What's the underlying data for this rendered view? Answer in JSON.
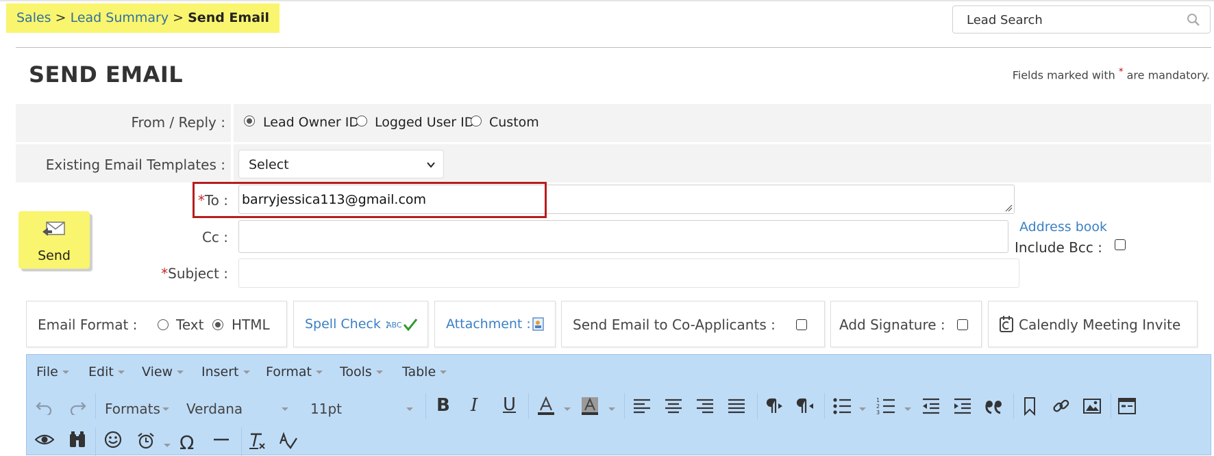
{
  "breadcrumb": {
    "items": [
      "Sales",
      "Lead Summary"
    ],
    "separator": ">",
    "current": "Send Email"
  },
  "search": {
    "placeholder": "Lead Search"
  },
  "page": {
    "title": "SEND EMAIL",
    "mandatory_prefix": "Fields marked with",
    "mandatory_star": "*",
    "mandatory_suffix": "are mandatory."
  },
  "from_reply": {
    "label": "From / Reply :",
    "options": [
      {
        "label": "Lead Owner ID",
        "selected": true
      },
      {
        "label": "Logged User ID",
        "selected": false
      },
      {
        "label": "Custom",
        "selected": false
      }
    ]
  },
  "templates": {
    "label": "Existing Email Templates :",
    "value": "Select"
  },
  "to": {
    "star": "*",
    "label": "To :",
    "value": "barryjessica113@gmail.com"
  },
  "cc": {
    "label": "Cc :",
    "value": ""
  },
  "subject": {
    "star": "*",
    "label": "Subject :",
    "value": ""
  },
  "address_book": "Address book",
  "include_bcc": {
    "label": "Include Bcc :",
    "checked": false
  },
  "send_button": {
    "label": "Send"
  },
  "options_bar": {
    "email_format": {
      "label": "Email Format :",
      "text_label": "Text",
      "html_label": "HTML",
      "selected": "HTML"
    },
    "spell_check": "Spell Check :",
    "spell_icon_text": "ABC",
    "attachment": "Attachment :",
    "co_applicants": {
      "label": "Send Email to Co-Applicants :",
      "checked": false
    },
    "signature": {
      "label": "Add Signature :",
      "checked": false
    },
    "calendly": "Calendly Meeting Invite"
  },
  "editor": {
    "menus": [
      "File",
      "Edit",
      "View",
      "Insert",
      "Format",
      "Tools",
      "Table"
    ],
    "formats_label": "Formats",
    "font_family": "Verdana",
    "font_size": "11pt",
    "bg_color": "#bfdcf7"
  }
}
